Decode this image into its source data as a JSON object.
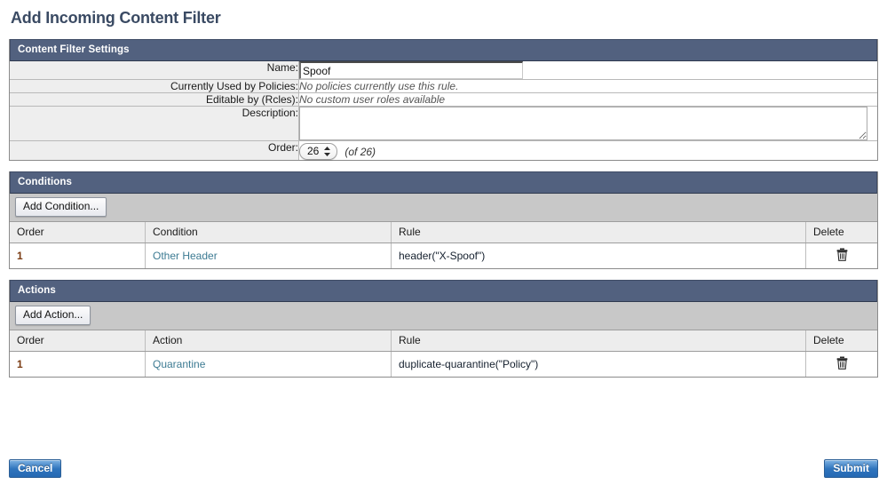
{
  "page": {
    "title": "Add Incoming Content Filter"
  },
  "settings": {
    "header": "Content Filter Settings",
    "rows": [
      {
        "label": "Name:",
        "type": "text-input"
      },
      {
        "label": "Currently Used by Policies:",
        "type": "static",
        "value": "No policies currently use this rule."
      },
      {
        "label": "Editable by (Rcles):",
        "type": "static",
        "value": "No custom user roles available"
      },
      {
        "label": "Description:",
        "type": "textarea"
      },
      {
        "label": "Order:",
        "type": "order"
      }
    ],
    "name_value": "Spoof",
    "name_placeholder": "",
    "description_value": "",
    "description_placeholder": "",
    "order_value": "26",
    "order_options": [
      "1",
      "26"
    ],
    "order_of_text": "(of 26)"
  },
  "conditions": {
    "header": "Conditions",
    "add_button": "Add Condition...",
    "columns": [
      "Order",
      "Condition",
      "Rule",
      "Delete"
    ],
    "rows": [
      {
        "order": "1",
        "name": "Other Header",
        "rule": "header(\"X-Spoof\")",
        "delete_icon": "trash-icon"
      }
    ]
  },
  "actions": {
    "header": "Actions",
    "add_button": "Add Action...",
    "columns": [
      "Order",
      "Action",
      "Rule",
      "Delete"
    ],
    "rows": [
      {
        "order": "1",
        "name": "Quarantine",
        "rule": "duplicate-quarantine(\"Policy\")",
        "delete_icon": "trash-icon"
      }
    ]
  },
  "footer": {
    "cancel_label": "Cancel",
    "submit_label": "Submit"
  },
  "colors": {
    "panel_header_bg": "#52617f",
    "title": "#3a4a63",
    "link": "#3d7b93",
    "order_num": "#7a3b12",
    "button_blue": "#2f74bd"
  }
}
